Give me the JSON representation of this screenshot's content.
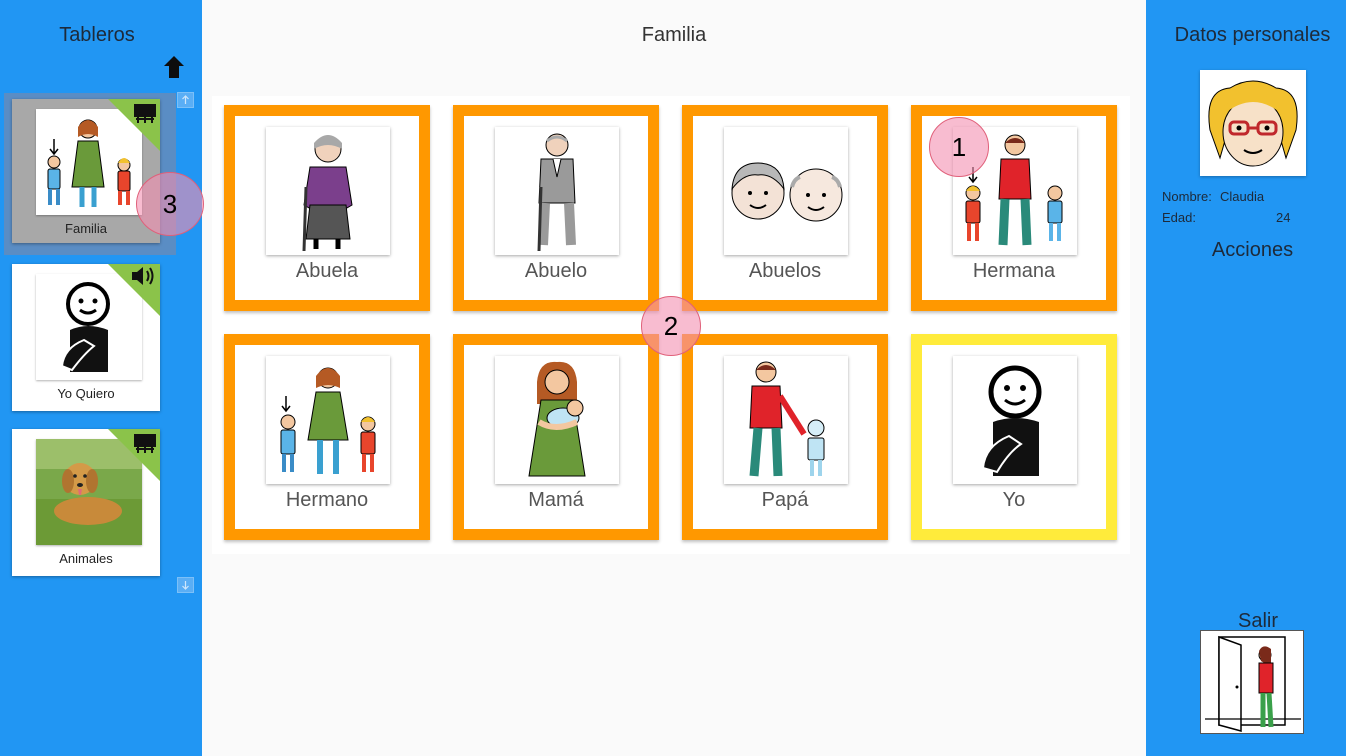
{
  "left_panel": {
    "title": "Tableros",
    "boards": [
      {
        "label": "Familia",
        "mode_icon": "monitor-icon",
        "selected": true
      },
      {
        "label": "Yo Quiero",
        "mode_icon": "speaker-icon",
        "selected": false
      },
      {
        "label": "Animales",
        "mode_icon": "monitor-icon",
        "selected": false
      }
    ]
  },
  "main": {
    "title": "Familia",
    "cards": [
      {
        "label": "Abuela",
        "border": "#ff9800"
      },
      {
        "label": "Abuelo",
        "border": "#ff9800"
      },
      {
        "label": "Abuelos",
        "border": "#ff9800"
      },
      {
        "label": "Hermana",
        "border": "#ff9800"
      },
      {
        "label": "Hermano",
        "border": "#ff9800"
      },
      {
        "label": "Mamá",
        "border": "#ff9800"
      },
      {
        "label": "Papá",
        "border": "#ff9800"
      },
      {
        "label": "Yo",
        "border": "#ffeb3b"
      }
    ]
  },
  "markers": [
    "1",
    "2",
    "3"
  ],
  "right_panel": {
    "title": "Datos personales",
    "nombre_label": "Nombre:",
    "nombre_value": "Claudia",
    "edad_label": "Edad:",
    "edad_value": "24",
    "acciones": "Acciones",
    "salir": "Salir"
  },
  "colors": {
    "sidebar": "#2196f3",
    "card_border": "#ff9800",
    "card_border_self": "#ffeb3b",
    "corner_tag": "#8bc34a"
  }
}
